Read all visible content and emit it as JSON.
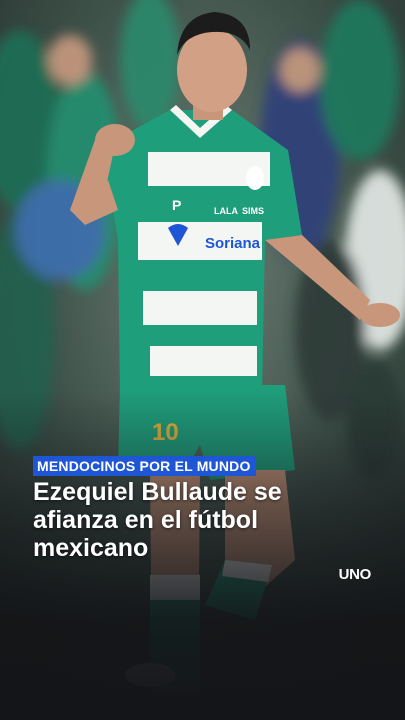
{
  "story": {
    "kicker": "MENDOCINOS POR EL MUNDO",
    "headline": "Ezequiel Bullaude se afianza en el fútbol mexicano"
  },
  "brand": {
    "logo": "UNO"
  },
  "photo": {
    "description_icon": "soccer-player-photo",
    "shirt_sponsor": "Soriana",
    "shirt_number": "10",
    "colors": {
      "kit_green": "#1f9e7b",
      "kit_white": "#f4f6f4",
      "kicker_bg": "#1f56d6"
    }
  }
}
